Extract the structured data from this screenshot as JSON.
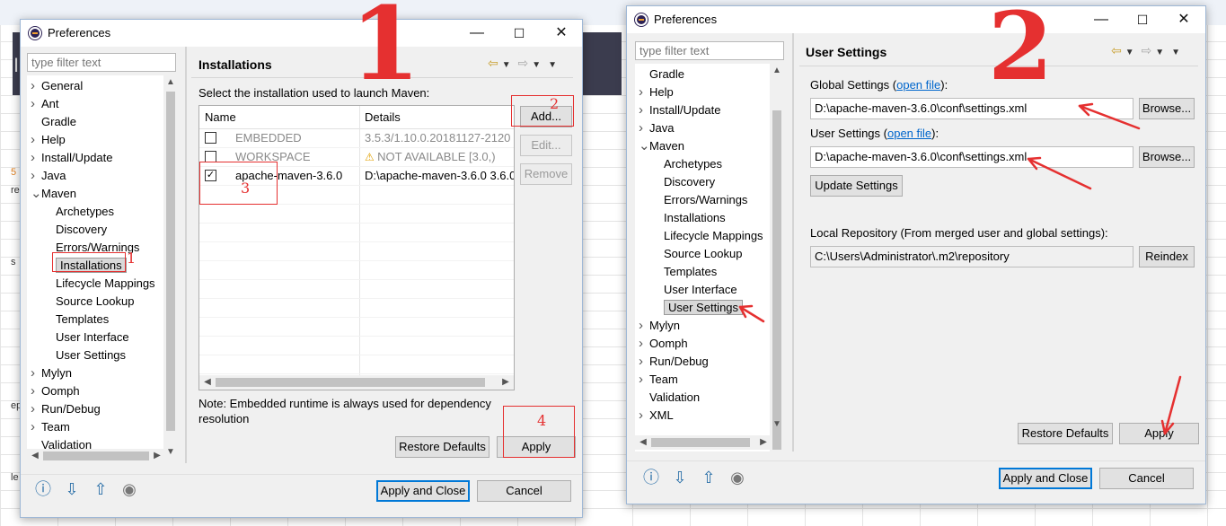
{
  "left_window": {
    "title": "Preferences",
    "filter_placeholder": "type filter text",
    "tree": [
      {
        "label": "General",
        "chev": ">"
      },
      {
        "label": "Ant",
        "chev": ">"
      },
      {
        "label": "Gradle",
        "chev": ""
      },
      {
        "label": "Help",
        "chev": ">"
      },
      {
        "label": "Install/Update",
        "chev": ">"
      },
      {
        "label": "Java",
        "chev": ">"
      },
      {
        "label": "Maven",
        "chev": "v"
      },
      {
        "label": "Archetypes",
        "chev": ""
      },
      {
        "label": "Discovery",
        "chev": ""
      },
      {
        "label": "Errors/Warnings",
        "chev": ""
      },
      {
        "label": "Installations",
        "chev": ""
      },
      {
        "label": "Lifecycle Mappings",
        "chev": ""
      },
      {
        "label": "Source Lookup",
        "chev": ""
      },
      {
        "label": "Templates",
        "chev": ""
      },
      {
        "label": "User Interface",
        "chev": ""
      },
      {
        "label": "User Settings",
        "chev": ""
      },
      {
        "label": "Mylyn",
        "chev": ">"
      },
      {
        "label": "Oomph",
        "chev": ">"
      },
      {
        "label": "Run/Debug",
        "chev": ">"
      },
      {
        "label": "Team",
        "chev": ">"
      },
      {
        "label": "Validation",
        "chev": ""
      }
    ],
    "page_title": "Installations",
    "instruction": "Select the installation used to launch Maven:",
    "columns": [
      "Name",
      "Details"
    ],
    "rows": [
      {
        "checked": "",
        "name": "EMBEDDED",
        "details": "3.5.3/1.10.0.20181127-2120"
      },
      {
        "checked": "",
        "name": "WORKSPACE",
        "details": "NOT AVAILABLE [3.0,)"
      },
      {
        "checked": "✓",
        "name": "apache-maven-3.6.0",
        "details": "D:\\apache-maven-3.6.0 3.6.0"
      }
    ],
    "btn_add": "Add...",
    "btn_edit": "Edit...",
    "btn_remove": "Remove",
    "note": "Note: Embedded runtime is always used for dependency resolution",
    "btn_restore": "Restore Defaults",
    "btn_apply": "Apply",
    "btn_apply_close": "Apply and Close",
    "btn_cancel": "Cancel"
  },
  "right_window": {
    "title": "Preferences",
    "filter_placeholder": "type filter text",
    "tree": [
      {
        "label": "Gradle",
        "chev": ""
      },
      {
        "label": "Help",
        "chev": ">"
      },
      {
        "label": "Install/Update",
        "chev": ">"
      },
      {
        "label": "Java",
        "chev": ">"
      },
      {
        "label": "Maven",
        "chev": "v"
      },
      {
        "label": "Archetypes",
        "chev": ""
      },
      {
        "label": "Discovery",
        "chev": ""
      },
      {
        "label": "Errors/Warnings",
        "chev": ""
      },
      {
        "label": "Installations",
        "chev": ""
      },
      {
        "label": "Lifecycle Mappings",
        "chev": ""
      },
      {
        "label": "Source Lookup",
        "chev": ""
      },
      {
        "label": "Templates",
        "chev": ""
      },
      {
        "label": "User Interface",
        "chev": ""
      },
      {
        "label": "User Settings",
        "chev": ""
      },
      {
        "label": "Mylyn",
        "chev": ">"
      },
      {
        "label": "Oomph",
        "chev": ">"
      },
      {
        "label": "Run/Debug",
        "chev": ">"
      },
      {
        "label": "Team",
        "chev": ">"
      },
      {
        "label": "Validation",
        "chev": ""
      },
      {
        "label": "XML",
        "chev": ">"
      }
    ],
    "page_title": "User Settings",
    "global_label": "Global Settings (",
    "global_link": "open file",
    "global_label_end": "):",
    "global_value": "D:\\apache-maven-3.6.0\\conf\\settings.xml",
    "user_label": "User Settings (",
    "user_link": "open file",
    "user_label_end": "):",
    "user_value": "D:\\apache-maven-3.6.0\\conf\\settings.xml",
    "btn_browse": "Browse...",
    "btn_update": "Update Settings",
    "local_repo_label": "Local Repository (From merged user and global settings):",
    "local_repo_value": "C:\\Users\\Administrator\\.m2\\repository",
    "btn_reindex": "Reindex",
    "btn_restore": "Restore Defaults",
    "btn_apply": "Apply",
    "btn_apply_close": "Apply and Close",
    "btn_cancel": "Cancel"
  },
  "annotations": {
    "big1": "1",
    "big2": "2",
    "n1": "1",
    "n2": "2",
    "n3": "3",
    "n4": "4"
  },
  "background_fragments": {
    "a": "I",
    "b": "5",
    "c": "re",
    "d": "ep",
    "e": "le",
    "f": "s"
  },
  "colors": {
    "annotation_red": "#e53030",
    "accent_blue": "#0078d7",
    "link": "#0066cc"
  }
}
